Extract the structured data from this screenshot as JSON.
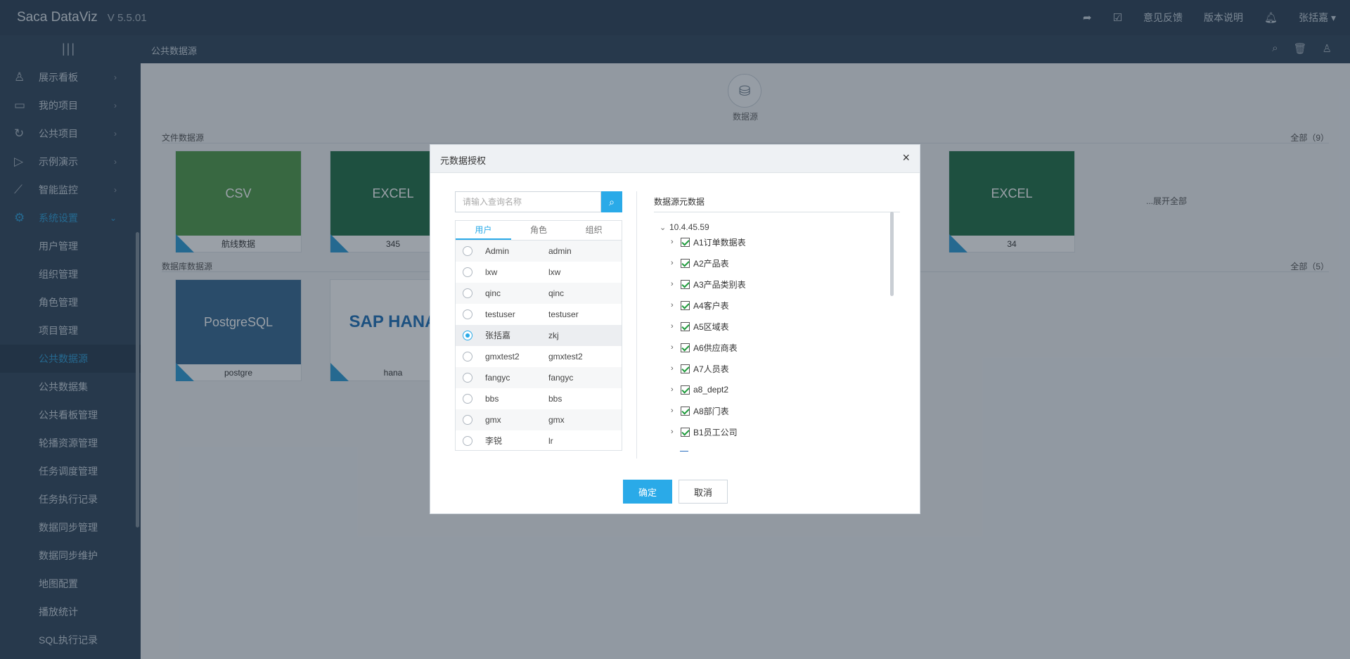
{
  "app": {
    "logo": "Saca DataViz",
    "version": "V 5.5.01"
  },
  "topbar": {
    "feedback": "意见反馈",
    "release_notes": "版本说明",
    "user": "张括嘉 ▾"
  },
  "subbar": {
    "breadcrumb": "公共数据源"
  },
  "sidebar": {
    "items": [
      {
        "label": "展示看板",
        "icon": "user-icon"
      },
      {
        "label": "我的项目",
        "icon": "monitor-icon"
      },
      {
        "label": "公共项目",
        "icon": "refresh-icon"
      },
      {
        "label": "示例演示",
        "icon": "play-icon"
      },
      {
        "label": "智能监控",
        "icon": "chart-icon"
      },
      {
        "label": "系统设置",
        "icon": "gear-icon"
      }
    ],
    "sub_items": [
      "用户管理",
      "组织管理",
      "角色管理",
      "项目管理",
      "公共数据源",
      "公共数据集",
      "公共看板管理",
      "轮播资源管理",
      "任务调度管理",
      "任务执行记录",
      "数据同步管理",
      "数据同步维护",
      "地图配置",
      "播放统计",
      "SQL执行记录"
    ]
  },
  "main": {
    "datasource_label": "数据源",
    "file_section": {
      "title": "文件数据源",
      "all": "全部（9）"
    },
    "db_section": {
      "title": "数据库数据源",
      "all": "全部（5）"
    },
    "expand_all": "...展开全部",
    "file_cards": [
      {
        "thumb": "CSV",
        "caption": "航线数据",
        "color": "#4e9a45"
      },
      {
        "thumb": "EXCEL",
        "caption": "345",
        "color": "#1e6e44"
      },
      {
        "thumb": "EXCEL",
        "caption": "34",
        "color": "#1e6e44"
      }
    ],
    "db_cards": [
      {
        "thumb": "PostgreSQL",
        "caption": "postgre",
        "color": "#336791"
      },
      {
        "thumb": "SAP HANA",
        "caption": "hana",
        "color": "#ffffff"
      }
    ]
  },
  "modal": {
    "title": "元数据授权",
    "close": "×",
    "search_placeholder": "请输入查询名称",
    "tabs": [
      "用户",
      "角色",
      "组织"
    ],
    "users": [
      {
        "name": "Admin",
        "account": "admin",
        "selected": false
      },
      {
        "name": "lxw",
        "account": "lxw",
        "selected": false
      },
      {
        "name": "qinc",
        "account": "qinc",
        "selected": false
      },
      {
        "name": "testuser",
        "account": "testuser",
        "selected": false
      },
      {
        "name": "张括嘉",
        "account": "zkj",
        "selected": true
      },
      {
        "name": "gmxtest2",
        "account": "gmxtest2",
        "selected": false
      },
      {
        "name": "fangyc",
        "account": "fangyc",
        "selected": false
      },
      {
        "name": "bbs",
        "account": "bbs",
        "selected": false
      },
      {
        "name": "gmx",
        "account": "gmx",
        "selected": false
      },
      {
        "name": "李锐",
        "account": "lr",
        "selected": false
      }
    ],
    "meta_title": "数据源元数据",
    "tree_root": "10.4.45.59",
    "tree_nodes": [
      "A1订单数据表",
      "A2产品表",
      "A3产品类别表",
      "A4客户表",
      "A5区域表",
      "A6供应商表",
      "A7人员表",
      "a8_dept2",
      "A8部门表",
      "B1员工公司"
    ],
    "ok": "确定",
    "cancel": "取消"
  }
}
